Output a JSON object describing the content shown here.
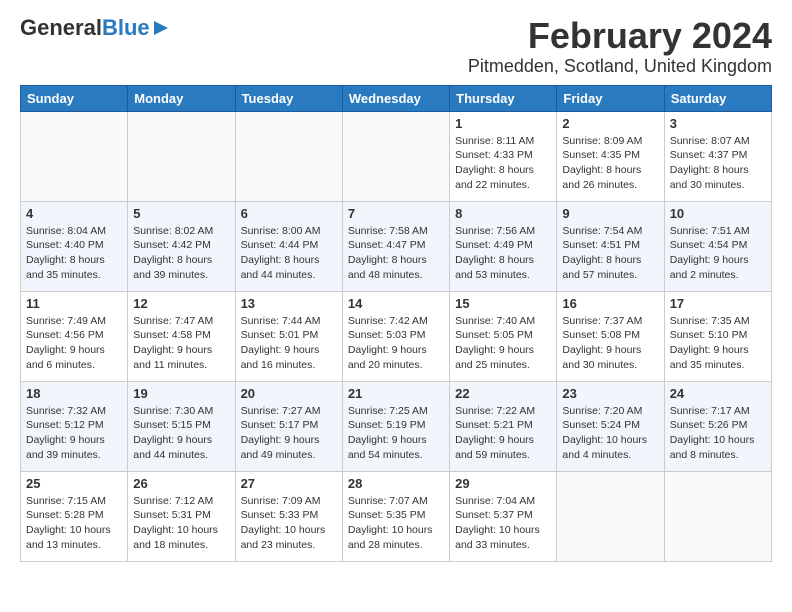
{
  "logo": {
    "general": "General",
    "blue": "Blue"
  },
  "title": "February 2024",
  "subtitle": "Pitmedden, Scotland, United Kingdom",
  "headers": [
    "Sunday",
    "Monday",
    "Tuesday",
    "Wednesday",
    "Thursday",
    "Friday",
    "Saturday"
  ],
  "weeks": [
    [
      {
        "day": "",
        "info": ""
      },
      {
        "day": "",
        "info": ""
      },
      {
        "day": "",
        "info": ""
      },
      {
        "day": "",
        "info": ""
      },
      {
        "day": "1",
        "info": "Sunrise: 8:11 AM\nSunset: 4:33 PM\nDaylight: 8 hours\nand 22 minutes."
      },
      {
        "day": "2",
        "info": "Sunrise: 8:09 AM\nSunset: 4:35 PM\nDaylight: 8 hours\nand 26 minutes."
      },
      {
        "day": "3",
        "info": "Sunrise: 8:07 AM\nSunset: 4:37 PM\nDaylight: 8 hours\nand 30 minutes."
      }
    ],
    [
      {
        "day": "4",
        "info": "Sunrise: 8:04 AM\nSunset: 4:40 PM\nDaylight: 8 hours\nand 35 minutes."
      },
      {
        "day": "5",
        "info": "Sunrise: 8:02 AM\nSunset: 4:42 PM\nDaylight: 8 hours\nand 39 minutes."
      },
      {
        "day": "6",
        "info": "Sunrise: 8:00 AM\nSunset: 4:44 PM\nDaylight: 8 hours\nand 44 minutes."
      },
      {
        "day": "7",
        "info": "Sunrise: 7:58 AM\nSunset: 4:47 PM\nDaylight: 8 hours\nand 48 minutes."
      },
      {
        "day": "8",
        "info": "Sunrise: 7:56 AM\nSunset: 4:49 PM\nDaylight: 8 hours\nand 53 minutes."
      },
      {
        "day": "9",
        "info": "Sunrise: 7:54 AM\nSunset: 4:51 PM\nDaylight: 8 hours\nand 57 minutes."
      },
      {
        "day": "10",
        "info": "Sunrise: 7:51 AM\nSunset: 4:54 PM\nDaylight: 9 hours\nand 2 minutes."
      }
    ],
    [
      {
        "day": "11",
        "info": "Sunrise: 7:49 AM\nSunset: 4:56 PM\nDaylight: 9 hours\nand 6 minutes."
      },
      {
        "day": "12",
        "info": "Sunrise: 7:47 AM\nSunset: 4:58 PM\nDaylight: 9 hours\nand 11 minutes."
      },
      {
        "day": "13",
        "info": "Sunrise: 7:44 AM\nSunset: 5:01 PM\nDaylight: 9 hours\nand 16 minutes."
      },
      {
        "day": "14",
        "info": "Sunrise: 7:42 AM\nSunset: 5:03 PM\nDaylight: 9 hours\nand 20 minutes."
      },
      {
        "day": "15",
        "info": "Sunrise: 7:40 AM\nSunset: 5:05 PM\nDaylight: 9 hours\nand 25 minutes."
      },
      {
        "day": "16",
        "info": "Sunrise: 7:37 AM\nSunset: 5:08 PM\nDaylight: 9 hours\nand 30 minutes."
      },
      {
        "day": "17",
        "info": "Sunrise: 7:35 AM\nSunset: 5:10 PM\nDaylight: 9 hours\nand 35 minutes."
      }
    ],
    [
      {
        "day": "18",
        "info": "Sunrise: 7:32 AM\nSunset: 5:12 PM\nDaylight: 9 hours\nand 39 minutes."
      },
      {
        "day": "19",
        "info": "Sunrise: 7:30 AM\nSunset: 5:15 PM\nDaylight: 9 hours\nand 44 minutes."
      },
      {
        "day": "20",
        "info": "Sunrise: 7:27 AM\nSunset: 5:17 PM\nDaylight: 9 hours\nand 49 minutes."
      },
      {
        "day": "21",
        "info": "Sunrise: 7:25 AM\nSunset: 5:19 PM\nDaylight: 9 hours\nand 54 minutes."
      },
      {
        "day": "22",
        "info": "Sunrise: 7:22 AM\nSunset: 5:21 PM\nDaylight: 9 hours\nand 59 minutes."
      },
      {
        "day": "23",
        "info": "Sunrise: 7:20 AM\nSunset: 5:24 PM\nDaylight: 10 hours\nand 4 minutes."
      },
      {
        "day": "24",
        "info": "Sunrise: 7:17 AM\nSunset: 5:26 PM\nDaylight: 10 hours\nand 8 minutes."
      }
    ],
    [
      {
        "day": "25",
        "info": "Sunrise: 7:15 AM\nSunset: 5:28 PM\nDaylight: 10 hours\nand 13 minutes."
      },
      {
        "day": "26",
        "info": "Sunrise: 7:12 AM\nSunset: 5:31 PM\nDaylight: 10 hours\nand 18 minutes."
      },
      {
        "day": "27",
        "info": "Sunrise: 7:09 AM\nSunset: 5:33 PM\nDaylight: 10 hours\nand 23 minutes."
      },
      {
        "day": "28",
        "info": "Sunrise: 7:07 AM\nSunset: 5:35 PM\nDaylight: 10 hours\nand 28 minutes."
      },
      {
        "day": "29",
        "info": "Sunrise: 7:04 AM\nSunset: 5:37 PM\nDaylight: 10 hours\nand 33 minutes."
      },
      {
        "day": "",
        "info": ""
      },
      {
        "day": "",
        "info": ""
      }
    ]
  ]
}
